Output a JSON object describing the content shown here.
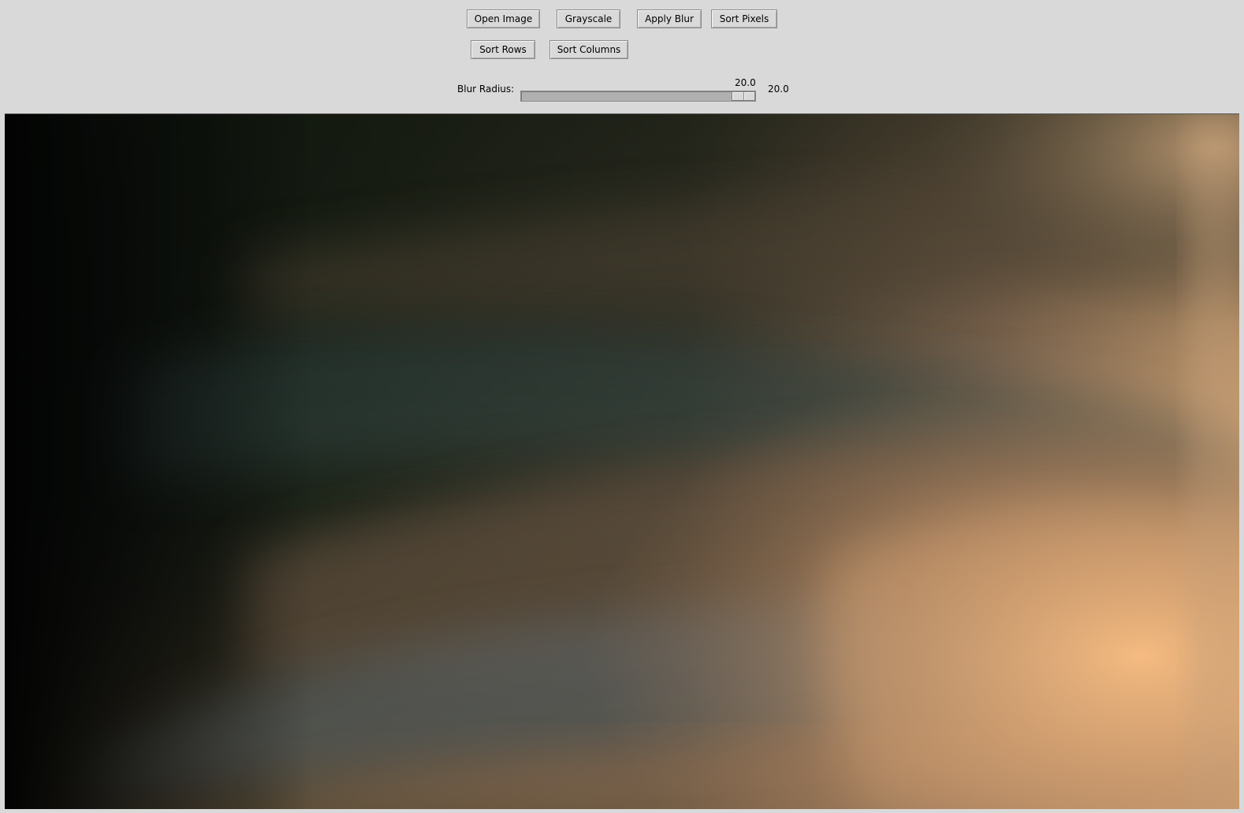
{
  "toolbar": {
    "open_image_label": "Open Image",
    "grayscale_label": "Grayscale",
    "apply_blur_label": "Apply Blur",
    "sort_pixels_label": "Sort Pixels",
    "sort_rows_label": "Sort Rows",
    "sort_columns_label": "Sort Columns"
  },
  "blur": {
    "label": "Blur Radius:",
    "slider_value_text": "20.0",
    "readout_text": "20.0",
    "value": 20.0
  },
  "canvas": {
    "content": "blurred image preview",
    "colors": {
      "dark": "#050605",
      "green_dark": "#1b2417",
      "teal": "#2e3c38",
      "brown": "#4b3b2c",
      "tan": "#9c7b60",
      "peach": "#f6bb80",
      "grey_blue": "#5a6062"
    }
  }
}
